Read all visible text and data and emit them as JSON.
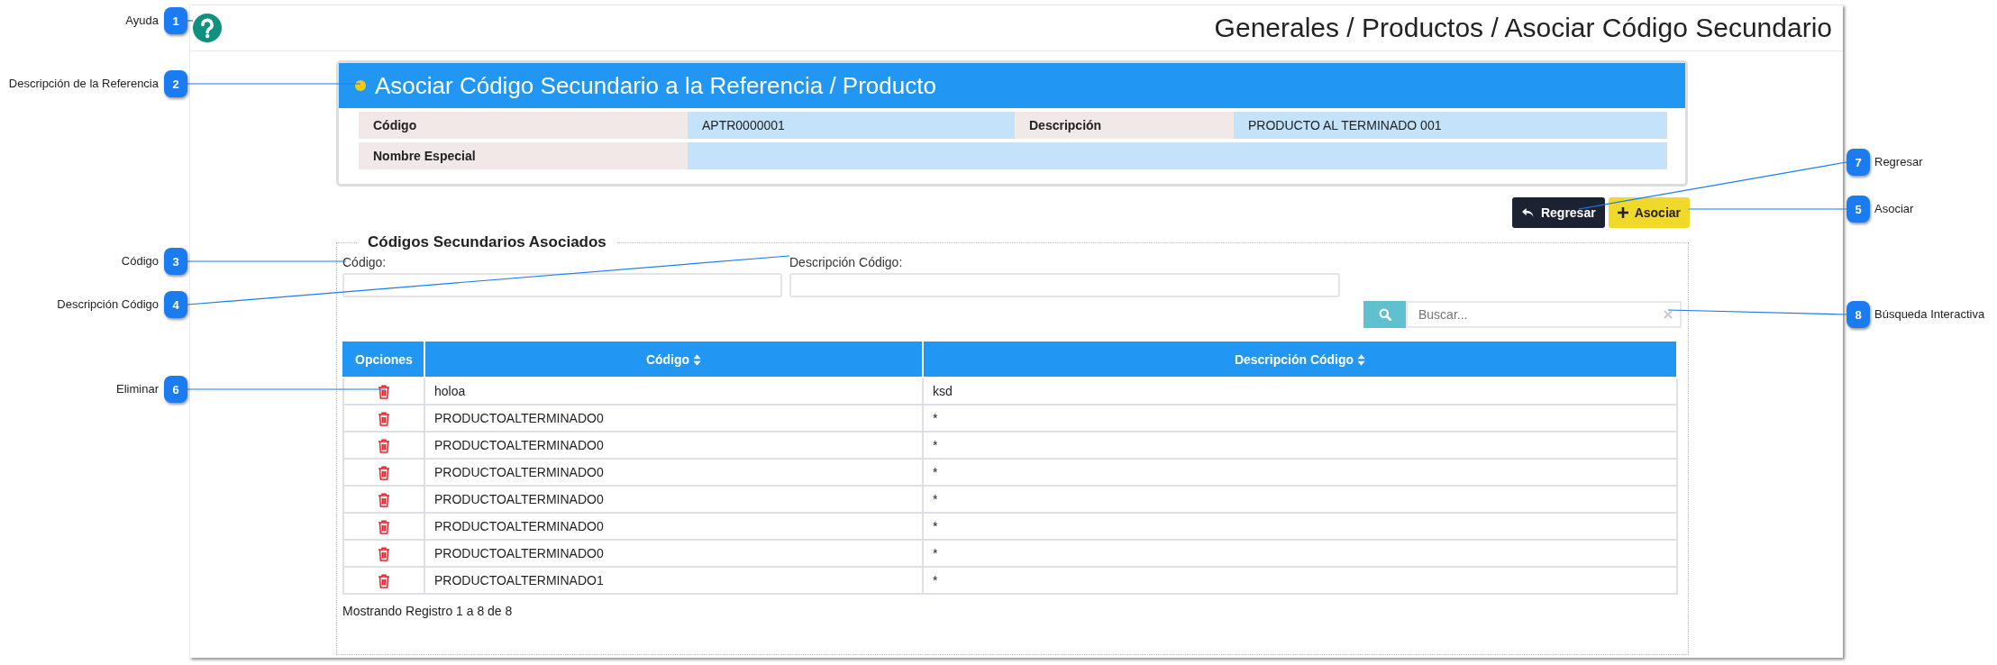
{
  "callouts": [
    {
      "number": "1",
      "label": "Ayuda"
    },
    {
      "number": "2",
      "label": "Descripción de la Referencia"
    },
    {
      "number": "3",
      "label": "Código"
    },
    {
      "number": "4",
      "label": "Descripción Código"
    },
    {
      "number": "6",
      "label": "Eliminar"
    },
    {
      "number": "7",
      "label": "Regresar"
    },
    {
      "number": "5",
      "label": "Asociar"
    },
    {
      "number": "8",
      "label": "Búsqueda Interactiva"
    }
  ],
  "breadcrumb": "Generales / Productos / Asociar Código Secundario",
  "card": {
    "title": "Asociar Código Secundario a la Referencia / Producto",
    "fields": [
      {
        "label": "Código",
        "value": "APTR0000001"
      },
      {
        "label": "Descripción",
        "value": "PRODUCTO AL TERMINADO 001"
      },
      {
        "label": "Nombre Especial"
      }
    ]
  },
  "buttons": [
    {
      "kind": "back",
      "label": "Regresar"
    },
    {
      "kind": "add",
      "label": "Asociar"
    }
  ],
  "section": {
    "title": "Códigos Secundarios Asociados",
    "filters": [
      {
        "label": "Código:"
      },
      {
        "label": "Descripción Código:"
      }
    ],
    "search": {
      "placeholder": "Buscar..."
    },
    "table": {
      "columns": [
        {
          "label": "Opciones",
          "sortable": false
        },
        {
          "label": "Código",
          "sortable": true
        },
        {
          "label": "Descripción Código",
          "sortable": true
        }
      ],
      "rows": [
        {
          "codigo": "holoa",
          "descripcion": "ksd"
        },
        {
          "codigo": "PRODUCTOALTERMINADO0",
          "descripcion": "*"
        },
        {
          "codigo": "PRODUCTOALTERMINADO0",
          "descripcion": "*"
        },
        {
          "codigo": "PRODUCTOALTERMINADO0",
          "descripcion": "*"
        },
        {
          "codigo": "PRODUCTOALTERMINADO0",
          "descripcion": "*"
        },
        {
          "codigo": "PRODUCTOALTERMINADO0",
          "descripcion": "*"
        },
        {
          "codigo": "PRODUCTOALTERMINADO0",
          "descripcion": "*"
        },
        {
          "codigo": "PRODUCTOALTERMINADO1",
          "descripcion": "*"
        }
      ]
    },
    "footer": "Mostrando Registro 1 a 8 de 8"
  }
}
